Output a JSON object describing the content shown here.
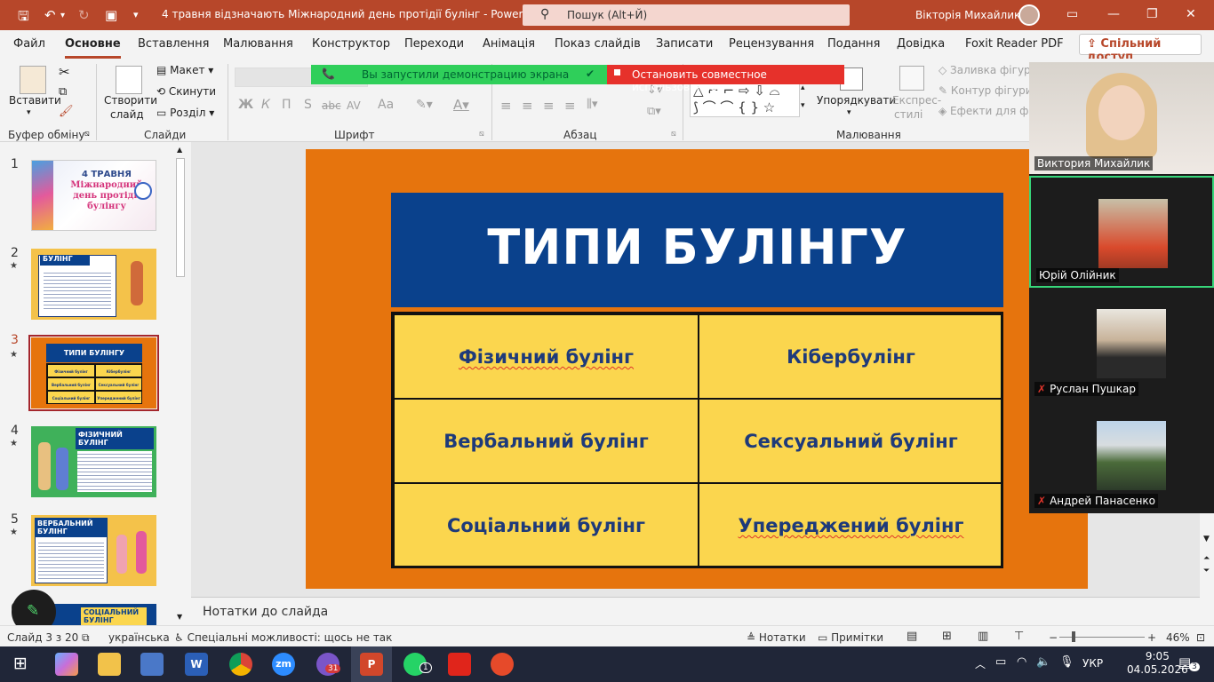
{
  "window": {
    "title": "4 травня відзначають Міжнародний день протідії булінг  -  PowerPoint",
    "search_placeholder": "Пошук (Alt+Й)",
    "user_name": "Вікторія Михайлик"
  },
  "menu": {
    "tabs": [
      "Файл",
      "Основне",
      "Вставлення",
      "Малювання",
      "Конструктор",
      "Переходи",
      "Анімація",
      "Показ слайдів",
      "Записати",
      "Рецензування",
      "Подання",
      "Довідка",
      "Foxit Reader PDF"
    ],
    "active_tab": "Основне",
    "share": "Спільний доступ"
  },
  "ribbon": {
    "clipboard": {
      "paste": "Вставити",
      "label": "Буфер обміну"
    },
    "slides": {
      "new_slide_1": "Створити",
      "new_slide_2": "слайд",
      "layout": "Макет",
      "reset": "Скинути",
      "section": "Розділ",
      "label": "Слайди"
    },
    "font": {
      "bold": "Ж",
      "italic": "К",
      "underline": "П",
      "shadow": "S",
      "strike": "abc",
      "spacing": "AV",
      "case": "Aa",
      "label": "Шрифт"
    },
    "paragraph": {
      "label": "Абзац"
    },
    "drawing": {
      "arrange": "Упорядкувати",
      "quick_styles_1": "Експрес-",
      "quick_styles_2": "стилі",
      "fill": "Заливка фігури",
      "outline": "Контур фігури",
      "effects": "Ефекти для фігу",
      "label": "Малювання"
    }
  },
  "share_banner": {
    "green_text": "Вы запустили демонстрацию экрана",
    "red_text": "Остановить совместное использование"
  },
  "thumbnails": [
    {
      "num": "1",
      "star": false,
      "title_lines": [
        "4 ТРАВНЯ",
        "Міжнародний",
        "день протідії",
        "булінгу"
      ]
    },
    {
      "num": "2",
      "star": true,
      "title": "БУЛІНГ"
    },
    {
      "num": "3",
      "star": true,
      "title": "ТИПИ БУЛІНГУ",
      "cells": [
        "Фізичний булінг",
        "Кібербулінг",
        "Вербальний булінг",
        "Сексуальний булінг",
        "Соціальний булінг",
        "Упереджений булінг"
      ],
      "selected": true
    },
    {
      "num": "4",
      "star": true,
      "title": "ФІЗИЧНИЙ БУЛІНГ"
    },
    {
      "num": "5",
      "star": true,
      "title": "ВЕРБАЛЬНИЙ БУЛІНГ"
    },
    {
      "num": "6",
      "star": false,
      "title": "СОЦІАЛЬНИЙ БУЛІНГ"
    }
  ],
  "slide": {
    "title": "ТИПИ БУЛІНГУ",
    "cells": [
      "Фізичний булінг",
      "Кібербулінг",
      "Вербальний булінг",
      "Сексуальний булінг",
      "Соціальний булінг",
      "Упереджений булінг"
    ]
  },
  "notes_placeholder": "Нотатки до слайда",
  "participants": [
    {
      "name": "Виктория Михайлик",
      "muted": false
    },
    {
      "name": "Юрій Олійник",
      "muted": false,
      "active_speaker": true
    },
    {
      "name": "Руслан Пушкар",
      "muted": true
    },
    {
      "name": "Андрей Панасенко",
      "muted": true
    }
  ],
  "status": {
    "slide_pos": "Слайд 3 з 20",
    "language": "українська",
    "accessibility": "Спеціальні можливості: щось не так",
    "notes": "Нотатки",
    "comments": "Примітки",
    "zoom": "46%"
  },
  "taskbar": {
    "lang": "УКР",
    "time": "9:05",
    "date": "04.05.2026",
    "notifications": "3",
    "viber_badge": "31",
    "whatsapp_badge": "1"
  },
  "colors": {
    "ppt_accent": "#b7472a",
    "slide_bg": "#e6740d",
    "title_bg": "#0a418c",
    "cell_bg": "#fbd64e",
    "cell_text": "#1e3a7a"
  }
}
